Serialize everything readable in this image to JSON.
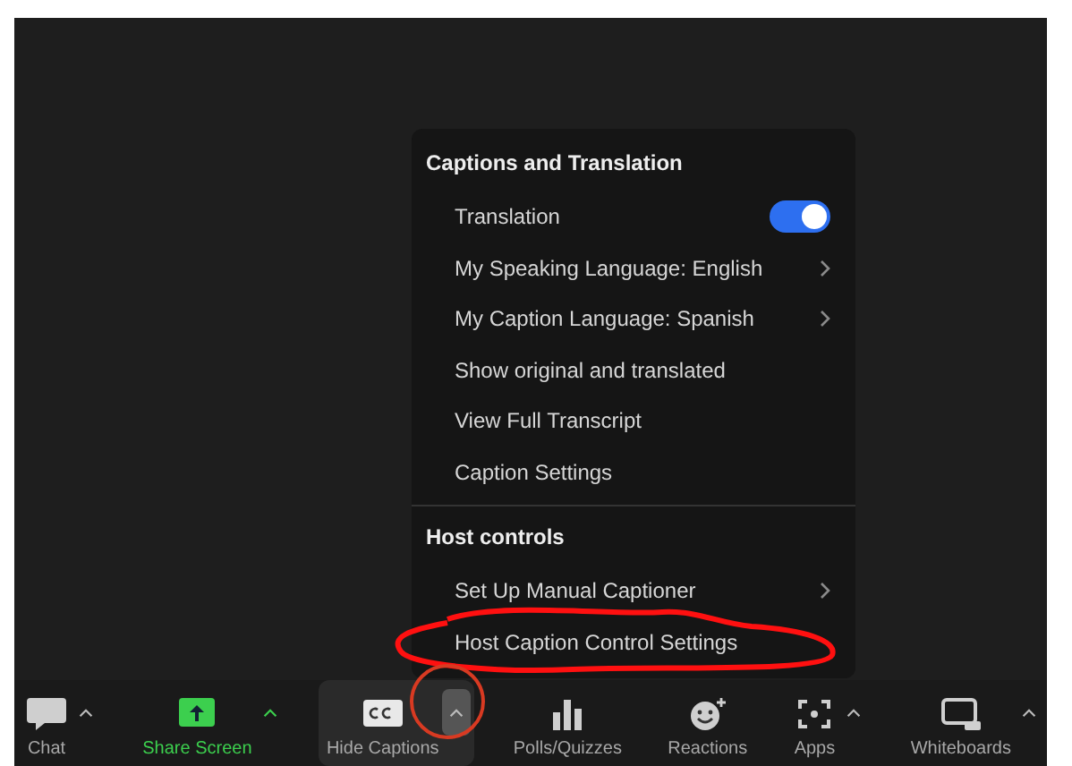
{
  "menu": {
    "sections": [
      {
        "heading": "Captions and Translation",
        "items": [
          {
            "label": "Translation",
            "kind": "toggle",
            "on": true
          },
          {
            "label": "My Speaking Language: English",
            "kind": "submenu"
          },
          {
            "label": "My Caption Language: Spanish",
            "kind": "submenu"
          },
          {
            "label": "Show original and translated",
            "kind": "plain"
          },
          {
            "label": "View Full Transcript",
            "kind": "plain"
          },
          {
            "label": "Caption Settings",
            "kind": "plain"
          }
        ]
      },
      {
        "heading": "Host controls",
        "items": [
          {
            "label": "Set Up Manual Captioner",
            "kind": "submenu"
          },
          {
            "label": "Host Caption Control Settings",
            "kind": "plain"
          }
        ]
      }
    ]
  },
  "toolbar": {
    "items": [
      {
        "label": "Chat",
        "kind": "chat",
        "caret": true,
        "selected": false,
        "caret_selected": false
      },
      {
        "label": "Share Screen",
        "kind": "share",
        "caret": true,
        "selected": false,
        "caret_selected": false,
        "color": "#3ccf4e"
      },
      {
        "label": "Hide Captions",
        "kind": "captions",
        "caret": true,
        "selected": true,
        "caret_selected": true
      },
      {
        "label": "Polls/Quizzes",
        "kind": "polls",
        "caret": false,
        "selected": false
      },
      {
        "label": "Reactions",
        "kind": "reactions",
        "caret": false,
        "selected": false
      },
      {
        "label": "Apps",
        "kind": "apps",
        "caret": true,
        "selected": false,
        "caret_selected": false
      },
      {
        "label": "Whiteboards",
        "kind": "whiteboards",
        "caret": true,
        "selected": false,
        "caret_selected": false
      }
    ]
  }
}
